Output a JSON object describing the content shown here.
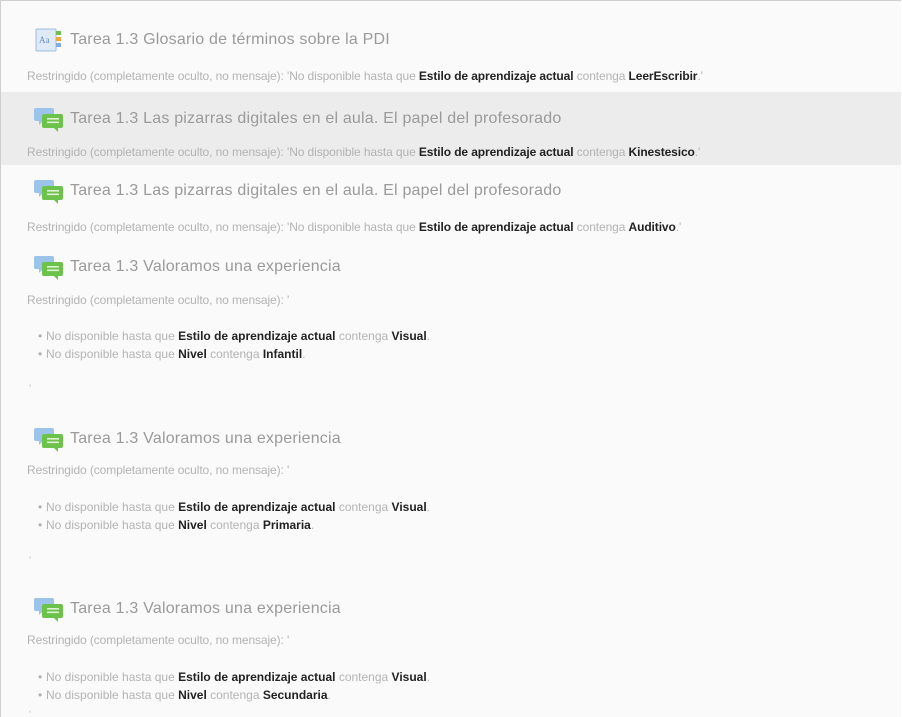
{
  "activities": [
    {
      "icon": "glossary-icon",
      "title": "Tarea 1.3 Glosario de términos sobre la PDI",
      "restriction": {
        "prefix": "Restringido (completamente oculto, no mensaje): 'No disponible hasta que ",
        "field": "Estilo de aprendizaje actual",
        "op": " contenga ",
        "value": "LeerEscribir",
        "suffix": ".'"
      }
    },
    {
      "icon": "forum-icon",
      "title": "Tarea 1.3 Las pizarras digitales en el aula. El papel del profesorado",
      "restriction": {
        "prefix": "Restringido (completamente oculto, no mensaje): 'No disponible hasta que ",
        "field": "Estilo de aprendizaje actual",
        "op": " contenga ",
        "value": "Kinestesico",
        "suffix": ".'"
      }
    },
    {
      "icon": "forum-icon",
      "title": "Tarea 1.3 Las pizarras digitales en el aula. El papel del profesorado",
      "restriction": {
        "prefix": "Restringido (completamente oculto, no mensaje): 'No disponible hasta que ",
        "field": "Estilo de aprendizaje actual",
        "op": " contenga ",
        "value": "Auditivo",
        "suffix": ".'"
      }
    },
    {
      "icon": "forum-icon",
      "title": "Tarea 1.3 Valoramos una experiencia",
      "restriction_label": "Restringido (completamente oculto, no mensaje): '",
      "conditions": [
        {
          "prefix": "No disponible hasta que ",
          "field": "Estilo de aprendizaje actual",
          "op": " contenga ",
          "value": "Visual",
          "suffix": "."
        },
        {
          "prefix": "No disponible hasta que ",
          "field": "Nivel",
          "op": " contenga ",
          "value": "Infantil",
          "suffix": "."
        }
      ],
      "closing": "'"
    },
    {
      "icon": "forum-icon",
      "title": "Tarea 1.3 Valoramos una experiencia",
      "restriction_label": "Restringido (completamente oculto, no mensaje): '",
      "conditions": [
        {
          "prefix": "No disponible hasta que ",
          "field": "Estilo de aprendizaje actual",
          "op": " contenga ",
          "value": "Visual",
          "suffix": "."
        },
        {
          "prefix": "No disponible hasta que ",
          "field": "Nivel",
          "op": " contenga ",
          "value": "Primaria",
          "suffix": "."
        }
      ],
      "closing": "'"
    },
    {
      "icon": "forum-icon",
      "title": "Tarea 1.3 Valoramos una experiencia",
      "restriction_label": "Restringido (completamente oculto, no mensaje): '",
      "conditions": [
        {
          "prefix": "No disponible hasta que ",
          "field": "Estilo de aprendizaje actual",
          "op": " contenga ",
          "value": "Visual",
          "suffix": "."
        },
        {
          "prefix": "No disponible hasta que ",
          "field": "Nivel",
          "op": " contenga ",
          "value": "Secundaria",
          "suffix": "."
        }
      ],
      "closing": "'"
    }
  ],
  "colors": {
    "title_gray": "#9a9a9a",
    "muted_gray": "#b3b3b3",
    "highlight_row": "#ececec",
    "forum_icon_green": "#6cc24a",
    "forum_icon_blue": "#7fb0e0"
  }
}
